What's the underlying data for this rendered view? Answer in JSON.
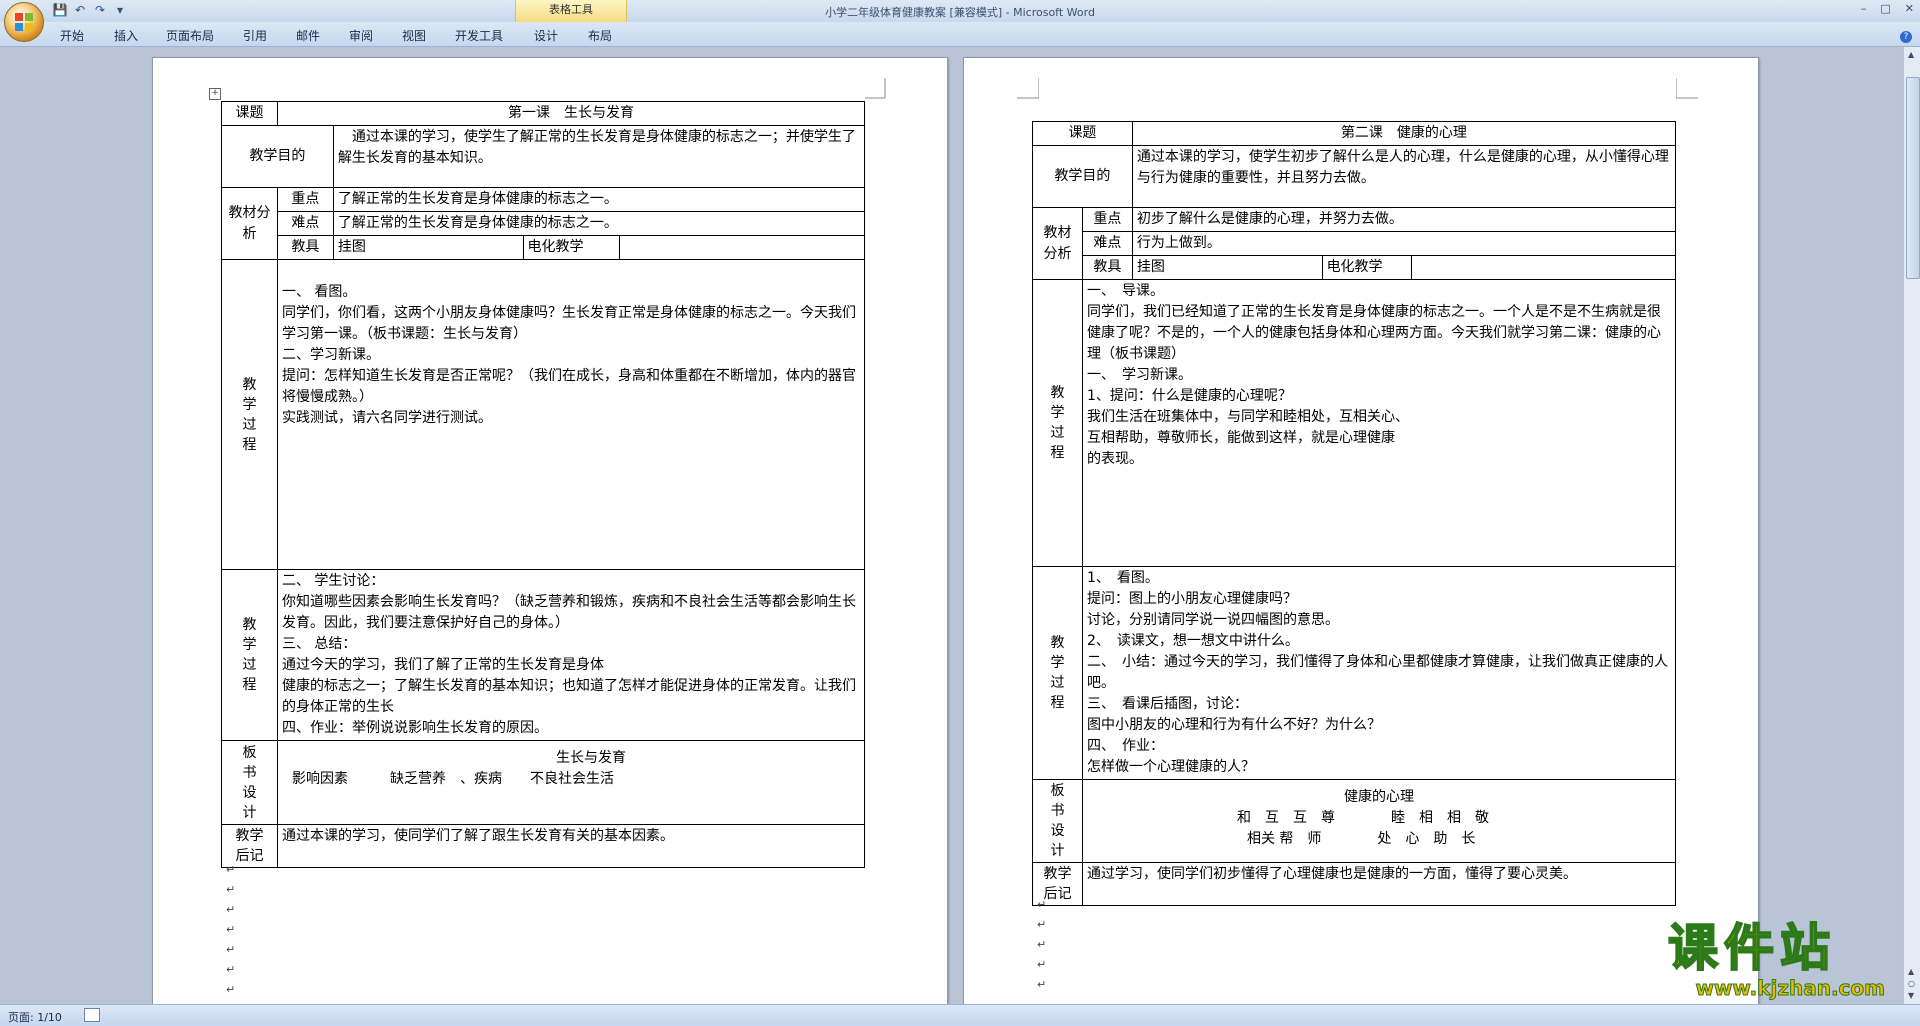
{
  "window": {
    "title": "小学二年级体育健康教案 [兼容模式] - Microsoft Word",
    "context_tab_title": "表格工具",
    "controls": [
      "–",
      "□",
      "✕"
    ]
  },
  "ribbon": {
    "tabs": [
      "开始",
      "插入",
      "页面布局",
      "引用",
      "邮件",
      "审阅",
      "视图",
      "开发工具",
      "设计",
      "布局"
    ]
  },
  "status": {
    "page": "页面: 1/10"
  },
  "lesson1": {
    "topic_label": "课题",
    "topic": "第一课　生长与发育",
    "goal_label": "教学目的",
    "goal": "　通过本课的学习，使学生了解正常的生长发育是身体健康的标志之一；并使学生了解生长发育的基本知识。",
    "analysis_label": "教材分析",
    "key_label": "重点",
    "key": "了解正常的生长发育是身体健康的标志之一。",
    "difficulty_label": "难点",
    "difficulty": "了解正常的生长发育是身体健康的标志之一。",
    "tools_label": "教具",
    "tools": "挂图",
    "media_label": "电化教学",
    "process_label": "教学过程",
    "process1": "一、 看图。\n同学们，你们看，这两个小朋友身体健康吗？生长发育正常是身体健康的标志之一。今天我们学习第一课。（板书课题：生长与发育）\n二、学习新课。\n提问：怎样知道生长发育是否正常呢？（我们在成长，身高和体重都在不断增加，体内的器官将慢慢成熟。）\n实践测试，请六名同学进行测试。",
    "process2": "二、 学生讨论：\n你知道哪些因素会影响生长发育吗？（缺乏营养和锻炼，疾病和不良社会生活等都会影响生长发育。因此，我们要注意保护好自己的身体。）\n三、 总结：\n通过今天的学习，我们了解了正常的生长发育是身体\n健康的标志之一；了解生长发育的基本知识；也知道了怎样才能促进身体的正常发育。让我们的身体正常的生长\n四、作业：举例说说影响生长发育的原因。",
    "board_label": "板书设计",
    "board_title": "生长与发育",
    "board_line": "影响因素　　　缺乏营养　、疾病　　不良社会生活",
    "note_label": "教学后记",
    "note": "通过本课的学习，使同学们了解了跟生长发育有关的基本因素。"
  },
  "lesson2": {
    "topic_label": "课题",
    "topic": "第二课　健康的心理",
    "goal_label": "教学目的",
    "goal": "通过本课的学习，使学生初步了解什么是人的心理，什么是健康的心理，从小懂得心理与行为健康的重要性，并且努力去做。",
    "analysis_label": "教材分析",
    "key_label": "重点",
    "key": "初步了解什么是健康的心理，并努力去做。",
    "difficulty_label": "难点",
    "difficulty": "行为上做到。",
    "tools_label": "教具",
    "tools": "挂图",
    "media_label": "电化教学",
    "process_label": "教学过程",
    "process1": "一、　导课。\n同学们，我们已经知道了正常的生长发育是身体健康的标志之一。一个人是不是不生病就是很健康了呢？不是的，一个人的健康包括身体和心理两方面。今天我们就学习第二课：健康的心理（板书课题）\n一、　学习新课。\n1、提问：什么是健康的心理呢？\n我们生活在班集体中，与同学和睦相处，互相关心、\n互相帮助，尊敬师长，能做到这样，就是心理健康\n的表现。",
    "process2": "1、　看图。\n提问：图上的小朋友心理健康吗？\n讨论，分别请同学说一说四幅图的意思。\n2、　读课文，想一想文中讲什么。\n二、　小结：通过今天的学习，我们懂得了身体和心里都健康才算健康，让我们做真正健康的人吧。\n三、　看课后插图，讨论：\n图中小朋友的心理和行为有什么不好？为什么？\n四、　作业：\n怎样做一个心理健康的人？",
    "board_label": "板书设计",
    "board_title": "健康的心理",
    "board_line1": "和　互　互　尊　　　　睦　相　相　敬",
    "board_line2": "相关 帮　师　　　　处　心　助　长",
    "note_label": "教学后记",
    "note": "通过学习，使同学们初步懂得了心理健康也是健康的一方面，懂得了要心灵美。"
  },
  "watermark": {
    "big": "课件站",
    "small": "www.kjzhan.com"
  }
}
